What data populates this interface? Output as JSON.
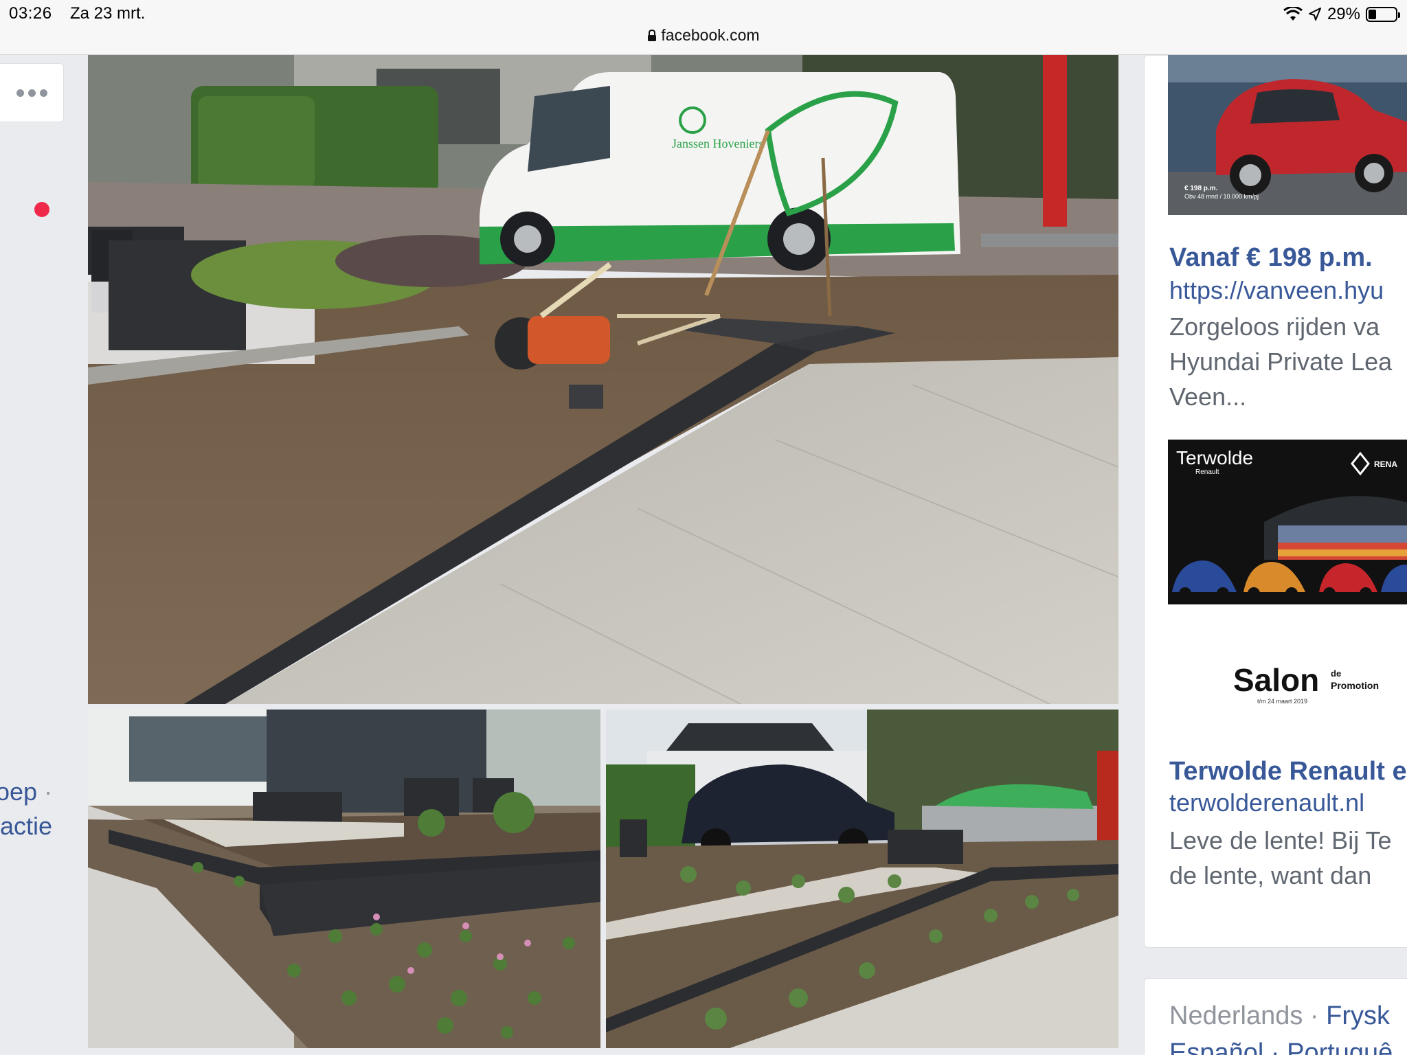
{
  "status_bar": {
    "time": "03:26",
    "date": "Za 23 mrt.",
    "battery_text": "29%",
    "battery_level": 0.29,
    "icons": [
      "wifi-icon",
      "location-arrow-icon",
      "battery-icon"
    ]
  },
  "browser": {
    "url": "facebook.com",
    "lock_icon": "lock-icon"
  },
  "left_panel": {
    "more_icon": "more-horizontal-icon",
    "line1": "oep",
    "line1_sep": " ·",
    "line2": "actie",
    "notification_color": "#f02849"
  },
  "post_photos": [
    {
      "name": "garden-work-in-progress"
    },
    {
      "name": "finished-garden-left"
    },
    {
      "name": "finished-garden-right"
    }
  ],
  "van_logo_text": "Janssen Hoveniers",
  "ads": [
    {
      "image_caption": "€ 198 p.m.",
      "image_subcaption": "Obv 48 mnd / 10.000 km/pj",
      "title": "Vanaf € 198 p.m.",
      "url": "https://vanveen.hyu",
      "description_lines": [
        "Zorgeloos rijden va",
        "Hyundai Private Lea",
        "Veen..."
      ]
    },
    {
      "image_brand": "Terwolde",
      "image_brand_sub": "Renault",
      "image_brand_right": "RENA",
      "image_salon": "Salon",
      "image_salon_de": "de",
      "image_salon_promo": "Promotion",
      "image_salon_date": "t/m 24 maart 2019",
      "title": "Terwolde Renault e",
      "url": "terwolderenault.nl",
      "description_lines": [
        "Leve de lente! Bij Te",
        "de lente, want dan"
      ]
    }
  ],
  "languages": {
    "current": "Nederlands",
    "separator": " · ",
    "next": "Frysk",
    "line2": "Español · Portuguê"
  },
  "colors": {
    "facebook_link": "#385898",
    "secondary_text": "#606770",
    "background": "#e9ebee"
  }
}
